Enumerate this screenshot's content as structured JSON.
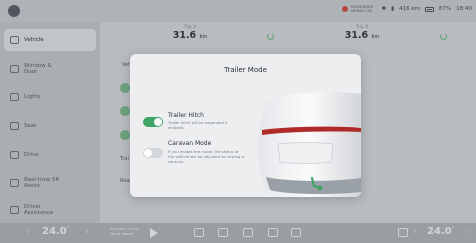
{
  "status": {
    "airbag_text": "PASSENGER AIRBAG ON",
    "range": "416 km",
    "battery": "87%",
    "time": "18:40"
  },
  "sidebar": {
    "items": [
      {
        "label": "Vehicle",
        "icon": "car-icon",
        "active": true
      },
      {
        "label": "Window & Door",
        "icon": "door-icon",
        "active": false
      },
      {
        "label": "Lights",
        "icon": "lights-icon",
        "active": false
      },
      {
        "label": "Seat",
        "icon": "seat-icon",
        "active": false
      },
      {
        "label": "Drive",
        "icon": "steering-icon",
        "active": false
      },
      {
        "label": "Real-time SR Assist",
        "icon": "assist-icon",
        "active": false
      },
      {
        "label": "Driver Assistance",
        "icon": "driver-assist-icon",
        "active": false
      }
    ]
  },
  "main": {
    "stat1": {
      "label": "Trip A",
      "value": "31.6",
      "unit": "km"
    },
    "stat2": {
      "label": "Trip B",
      "value": "31.6",
      "unit": "km"
    },
    "hint_text": "Vehi...",
    "trailer_fragment": "Trai",
    "rear_fragment": "Rear"
  },
  "modal": {
    "title": "Trailer Mode",
    "options": [
      {
        "title": "Trailer Hitch",
        "desc": "Trailer hitch will be expanded if enabled.",
        "on": true
      },
      {
        "title": "Caravan Mode",
        "desc": "If you enable the mode, the status of the vehicle will be adjusted for towing a caravan.",
        "on": false
      }
    ]
  },
  "bottombar": {
    "temp_left": "24.0",
    "temp_right": "24.0",
    "temp_unit": "°",
    "media_title": "Anytime, Anyw...",
    "media_sub": "Music Name",
    "accent": "#3fa566"
  }
}
